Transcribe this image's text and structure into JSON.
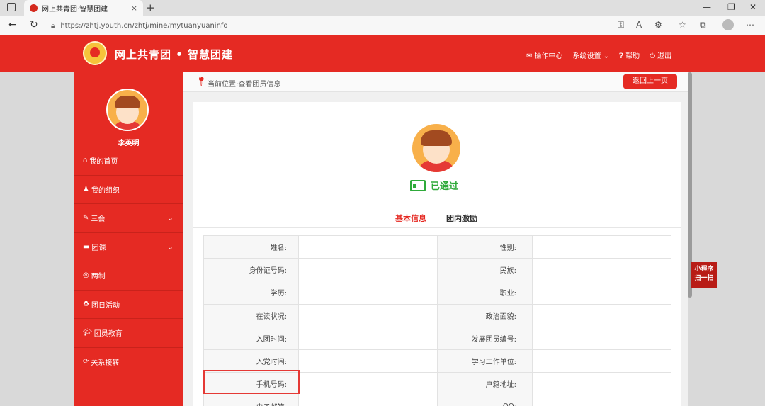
{
  "browser": {
    "tab_title": "网上共青团·智慧团建",
    "url": "https://zhtj.youth.cn/zhtj/mine/mytuanyuaninfo",
    "new_tab": "+",
    "close_tab": "×"
  },
  "header": {
    "brand": "网上共青团 • 智慧团建",
    "nav": [
      {
        "icon": "mail-icon",
        "label": "操作中心"
      },
      {
        "icon": "chevron-down-icon",
        "label": "系统设置"
      },
      {
        "icon": "help-icon",
        "label": "帮助"
      },
      {
        "icon": "power-icon",
        "label": "退出"
      }
    ]
  },
  "sidebar": {
    "user_name": "李英明",
    "items": [
      {
        "label": "我的首页",
        "icon": "home-icon"
      },
      {
        "label": "我的组织",
        "icon": "group-icon"
      },
      {
        "label": "三会",
        "icon": "edit-icon",
        "chevron": true
      },
      {
        "label": "团课",
        "icon": "folder-icon",
        "chevron": true
      },
      {
        "label": "两制",
        "icon": "target-icon"
      },
      {
        "label": "团日活动",
        "icon": "recycle-icon"
      },
      {
        "label": "团员教育",
        "icon": "graduation-cap-icon"
      },
      {
        "label": "关系接转",
        "icon": "refresh-icon"
      }
    ]
  },
  "breadcrumb": {
    "text": "当前位置:查看团员信息",
    "back_label": "返回上一页"
  },
  "profile": {
    "status": "已通过",
    "status_color": "#2eaa3a",
    "tabs": [
      {
        "label": "基本信息",
        "active": true
      },
      {
        "label": "团内激励",
        "active": false
      }
    ],
    "rows": [
      {
        "left": "姓名:",
        "right": "性别:"
      },
      {
        "left": "身份证号码:",
        "right": "民族:"
      },
      {
        "left": "学历:",
        "right": "职业:"
      },
      {
        "left": "在读状况:",
        "right": "政治面貌:"
      },
      {
        "left": "入团时间:",
        "right": "发展团员编号:"
      },
      {
        "left": "入党时间:",
        "right": "学习工作单位:"
      },
      {
        "left": "手机号码:",
        "right": "户籍地址:"
      },
      {
        "left": "电子邮箱:",
        "right": "QQ:"
      }
    ]
  },
  "mini_program": {
    "line1": "小程序",
    "line2": "扫一扫"
  },
  "colors": {
    "brand_red": "#e52a23",
    "highlight": "#e53935"
  }
}
